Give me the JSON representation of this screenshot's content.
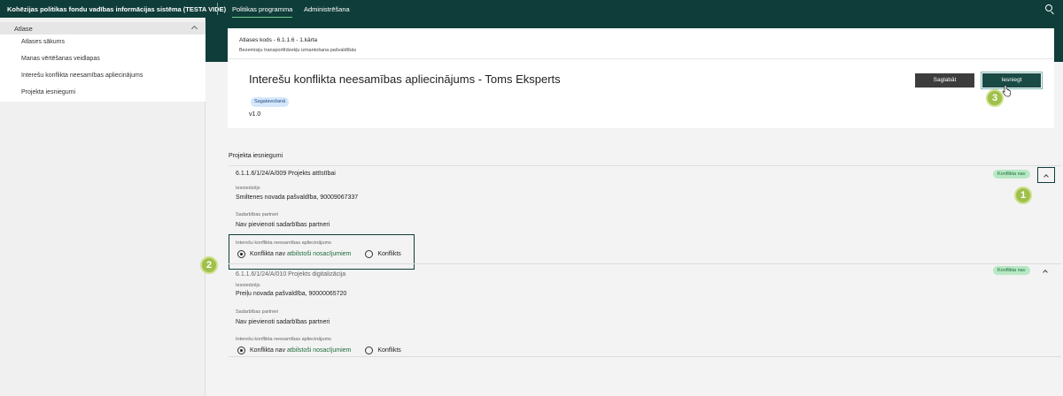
{
  "topbar": {
    "app_title": "Kohēzijas politikas fondu vadības informācijas sistēma (TESTA VIDE)",
    "nav_items": [
      "Politikas programma",
      "Administrēšana"
    ]
  },
  "sidebar": {
    "section": "Atlase",
    "items": [
      {
        "label": "Atlases sākums"
      },
      {
        "label": "Manas vērtēšanas veidlapas"
      },
      {
        "label": "Interešu konflikta neesamības apliecinājums"
      },
      {
        "label": "Projekta iesniegumi"
      }
    ]
  },
  "header": {
    "code": "Atlases kods - 6.1.1.6 - 1.kārta",
    "subtitle": "Bezemisiju transportlīdzekļu izmantošana pašvaldībās",
    "title": "Interešu konflikta neesamības apliecinājums - Toms Eksperts",
    "badge": "Sagatavošanā",
    "version": "v1.0",
    "save_label": "Saglabāt",
    "submit_label": "Iesniegt"
  },
  "steps": [
    "1",
    "2",
    "3"
  ],
  "submissions": {
    "title": "Projekta iesniegumi",
    "projects": [
      {
        "name": "6.1.1.6/1/24/A/009 Projekts attīstībai",
        "status": "Konflikta nav",
        "applicant_label": "Iesniedzējs",
        "applicant": "Smiltenes novada pašvaldība, 90009067337",
        "partners_label": "Sadarbības partneri",
        "partners": "Nav pievienoti sadarbības partneri",
        "declaration_label": "Interešu konflikta neesamības apliecinājums",
        "option_no_conflict_a": "Konflikta nav ",
        "option_no_conflict_b": "atbilstoši nosacījumiem",
        "option_conflict": "Konflikts",
        "selected": "no_conflict"
      },
      {
        "name": "6.1.1.6/1/24/A/010 Projekts digitalizācija",
        "status": "Konflikta nav",
        "applicant_label": "Iesniedzējs",
        "applicant": "Preiļu novada pašvaldība, 90000065720",
        "partners_label": "Sadarbības partneri",
        "partners": "Nav pievienoti sadarbības partneri",
        "declaration_label": "Interešu konflikta neesamības apliecinājums",
        "option_no_conflict_a": "Konflikta nav ",
        "option_no_conflict_b": "atbilstoši nosacījumiem",
        "option_conflict": "Konflikts",
        "selected": "no_conflict"
      }
    ]
  }
}
